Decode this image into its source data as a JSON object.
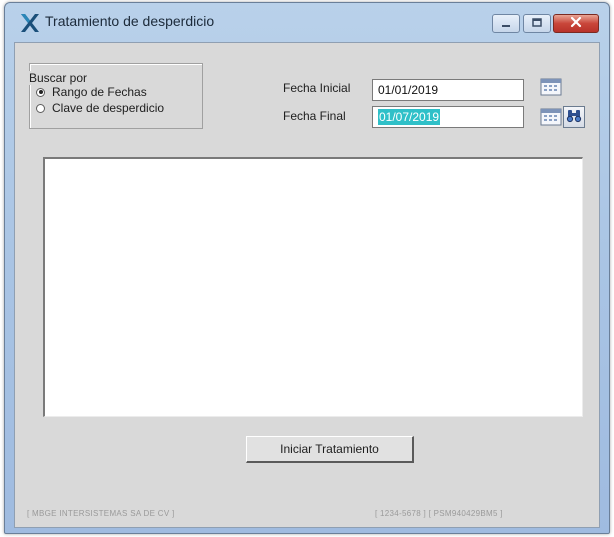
{
  "window": {
    "title": "Tratamiento de desperdicio",
    "controls": {
      "minimize": "minimize-icon",
      "maximize": "maximize-icon",
      "close": "close-icon"
    }
  },
  "search": {
    "group_label": "Buscar por",
    "options": [
      {
        "label": "Rango de Fechas",
        "checked": true
      },
      {
        "label": "Clave de desperdicio",
        "checked": false
      }
    ]
  },
  "dates": {
    "start_label": "Fecha Inicial",
    "start_value": "01/01/2019",
    "end_label": "Fecha Final",
    "end_value": "01/07/2019"
  },
  "actions": {
    "start_button": "Iniciar Tratamiento"
  },
  "footer": {
    "company": "[ MBGE INTERSISTEMAS SA DE CV ]",
    "codes": "[ 1234-5678 ]  [ PSM940429BM5 ]"
  },
  "colors": {
    "selection": "#2fc0c8",
    "titlebar": "#b9d1ea",
    "close_button": "#c9463a"
  }
}
